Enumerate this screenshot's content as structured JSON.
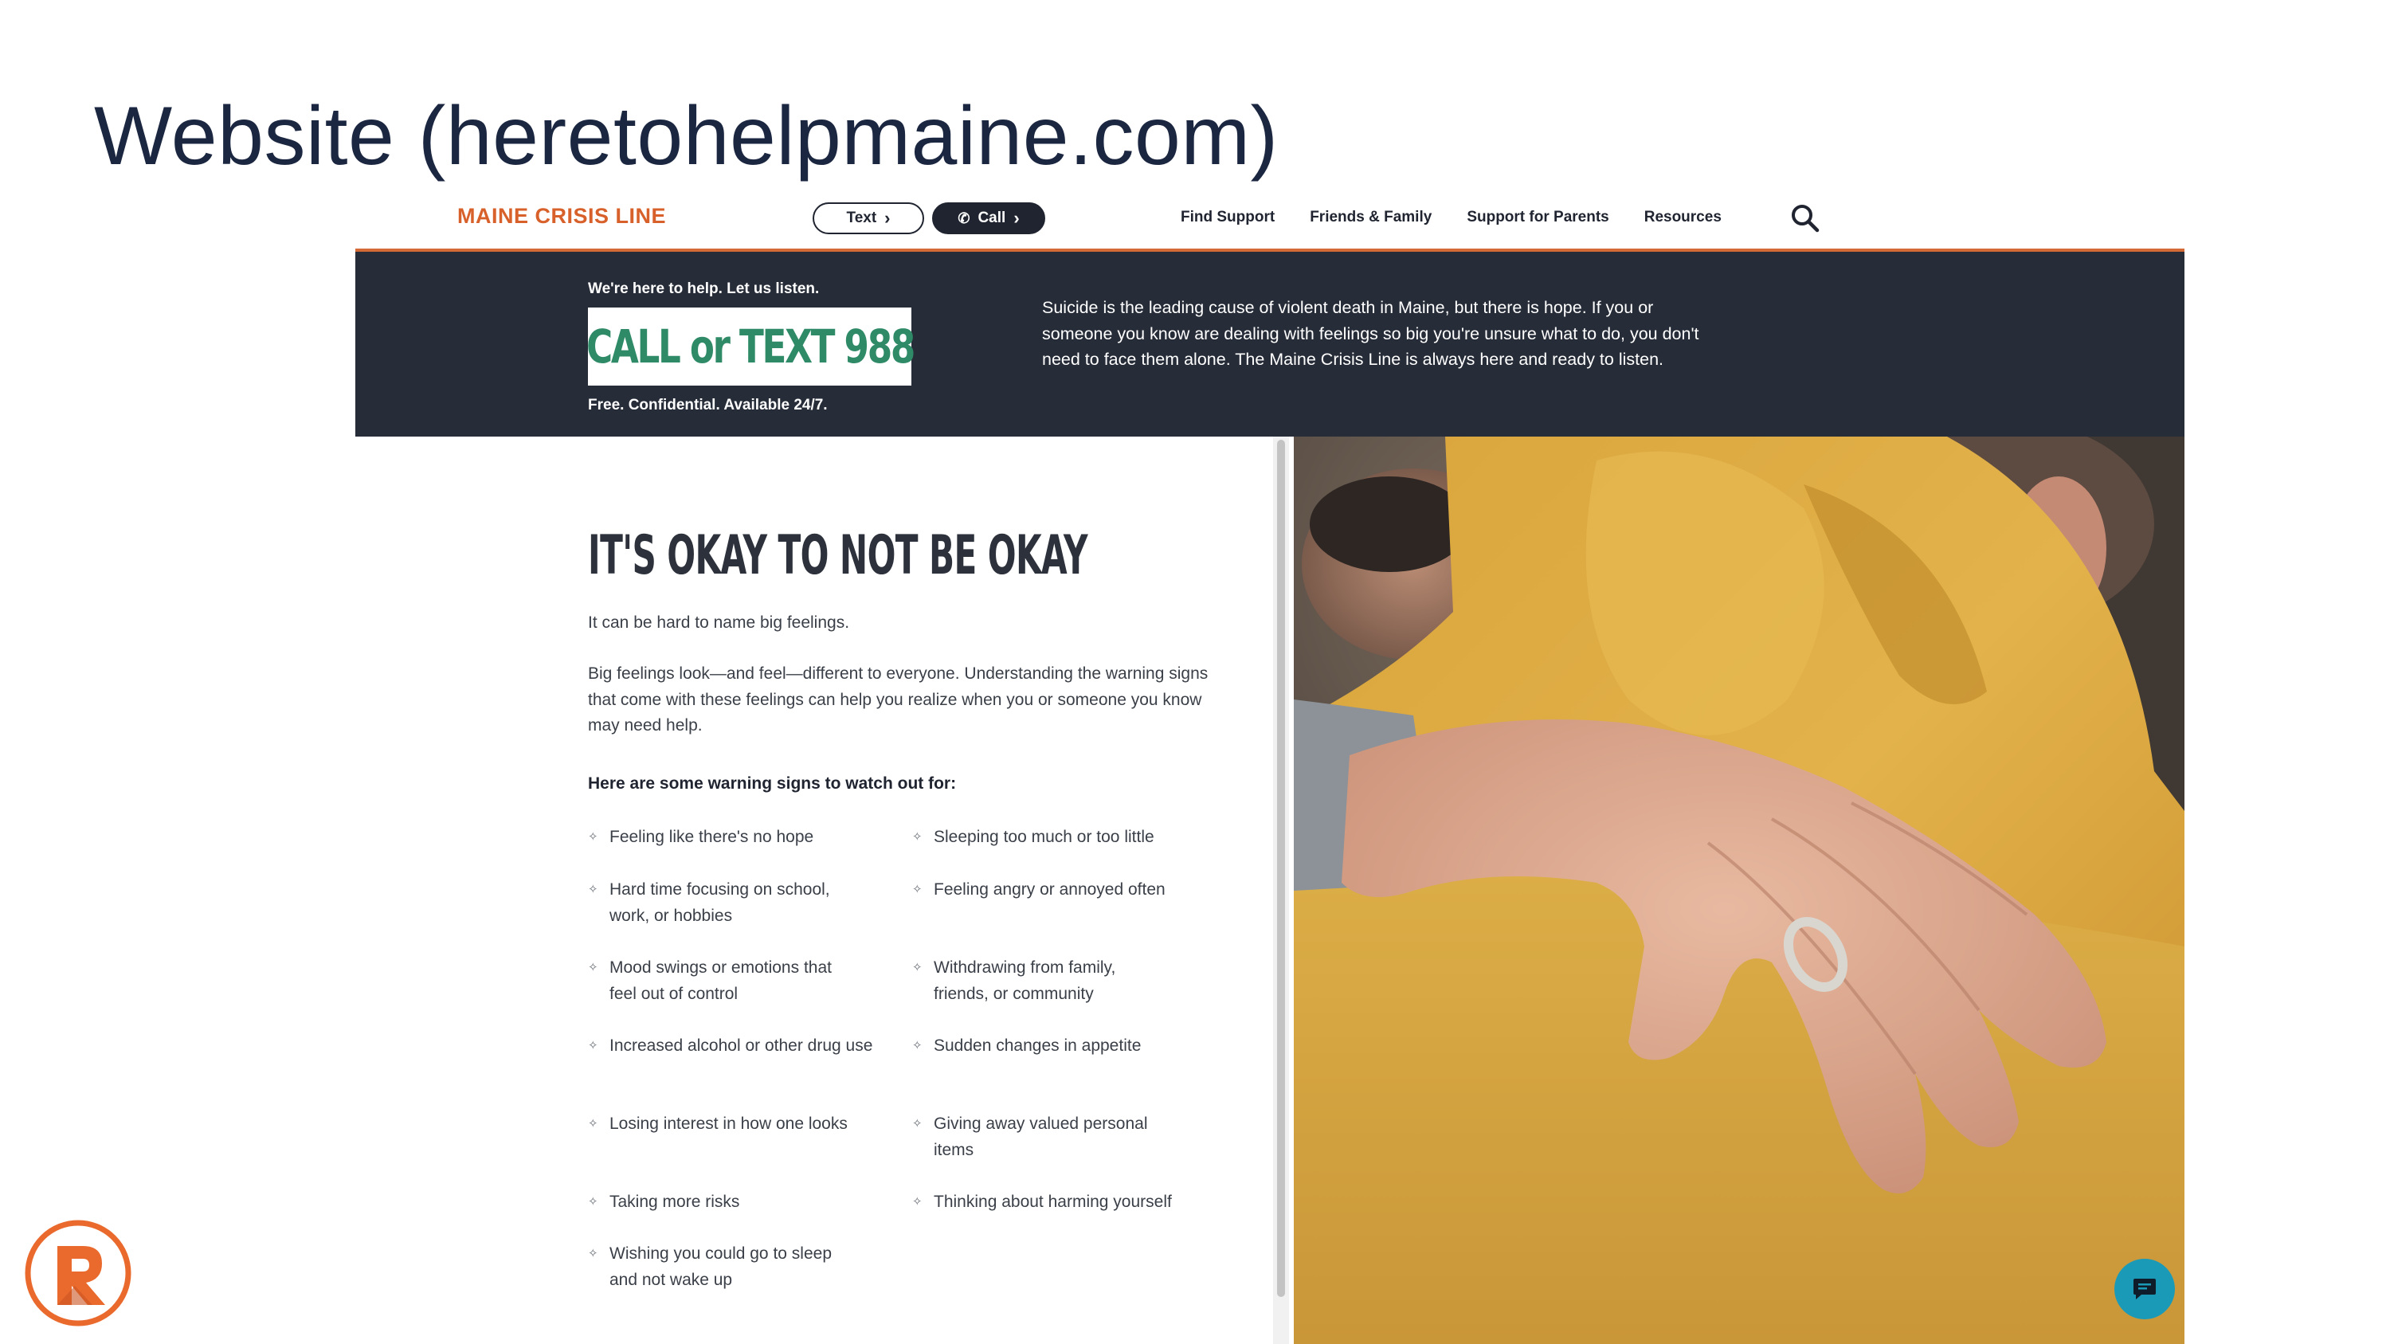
{
  "slide": {
    "title": "Website (heretohelpmaine.com)"
  },
  "nav": {
    "logo": "MAINE CRISIS LINE",
    "text_button": "Text",
    "call_button": "Call",
    "links": [
      "Find Support",
      "Friends & Family",
      "Support for Parents",
      "Resources"
    ]
  },
  "banner": {
    "kicker": "We're here to help. Let us listen.",
    "cta": "CALL or TEXT 988",
    "sub": "Free. Confidential. Available 24/7.",
    "body": "Suicide is the leading cause of violent death in Maine, but there is hope. If you or someone you know are dealing with feelings so big you're unsure what to do, you don't need to face them alone. The Maine Crisis Line is always here and ready to listen."
  },
  "content": {
    "heading": "IT'S OKAY TO NOT BE OKAY",
    "intro": "It can be hard to name big feelings.",
    "paragraph": "Big feelings look—and feel—different to everyone. Understanding the warning signs that come with these feelings can help you realize when you or someone you know may need help.",
    "signs_heading": "Here are some warning signs to watch out for:",
    "signs_left": [
      "Feeling like there's no hope",
      "Hard time focusing on school, work, or hobbies",
      "Mood swings or emotions that feel out of control",
      "Increased alcohol or other drug use",
      "Losing interest in how one looks",
      "Taking more risks",
      "Wishing you could go to sleep and not wake up"
    ],
    "signs_right": [
      "Sleeping too much or too little",
      "Feeling angry or annoyed often",
      "Withdrawing from family, friends, or community",
      "Sudden changes in appetite",
      "Giving away valued personal items",
      "Thinking about harming yourself"
    ]
  },
  "icons": {
    "search": "search-icon",
    "phone": "phone-icon",
    "chat": "chat-icon",
    "bullet": "diamond-bullet-icon"
  },
  "colors": {
    "brand_orange": "#d8602a",
    "banner_bg": "#262c38",
    "cta_green": "#2f8a67",
    "chat_teal": "#1b9ab8",
    "title_navy": "#1b2740"
  }
}
